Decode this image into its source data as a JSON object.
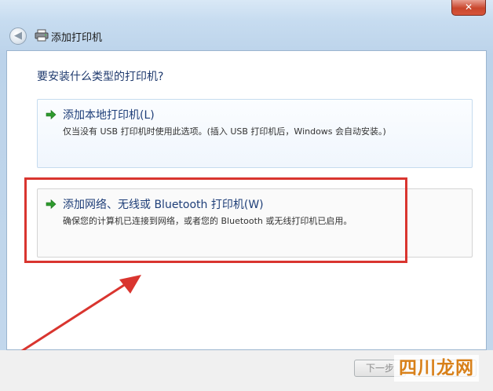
{
  "window": {
    "title": "添加打印机",
    "close_glyph": "✕",
    "back_glyph": "◀"
  },
  "main": {
    "question": "要安装什么类型的打印机?"
  },
  "options": [
    {
      "title": "添加本地打印机(L)",
      "description": "仅当没有 USB 打印机时使用此选项。(插入 USB 打印机后，Windows 会自动安装。)"
    },
    {
      "title": "添加网络、无线或 Bluetooth 打印机(W)",
      "description": "确保您的计算机已连接到网络，或者您的 Bluetooth 或无线打印机已启用。"
    }
  ],
  "footer": {
    "next_label": "下一步",
    "cancel_label": ""
  },
  "watermark": "四川龙网",
  "colors": {
    "annotation": "#d9352f",
    "option_title": "#1e3e78",
    "arrow_green": "#2e9b2e"
  }
}
